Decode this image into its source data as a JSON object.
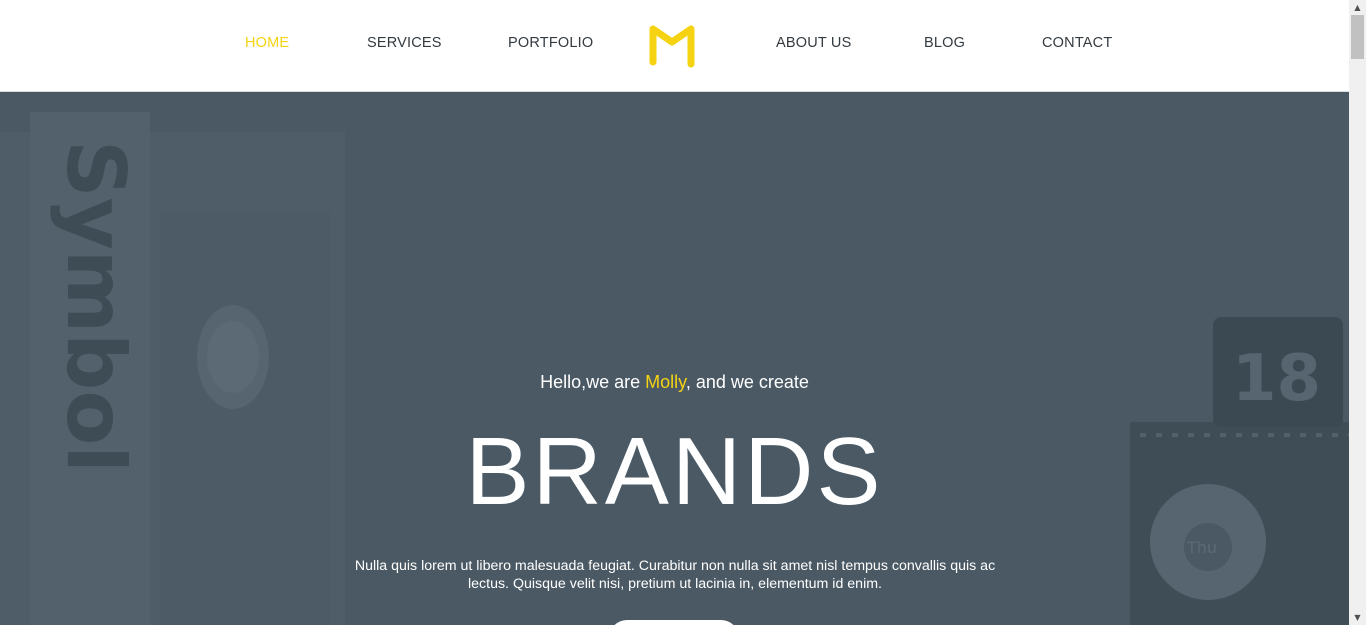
{
  "nav": {
    "items": [
      {
        "label": "HOME",
        "active": true
      },
      {
        "label": "SERVICES"
      },
      {
        "label": "PORTFOLIO"
      },
      {
        "label": "ABOUT US"
      },
      {
        "label": "BLOG"
      },
      {
        "label": "CONTACT"
      }
    ],
    "logo_icon": "m-logo-icon"
  },
  "hero": {
    "intro_before": "Hello,we are ",
    "intro_name": "Molly",
    "intro_after": ", and we create",
    "title": "BRANDS",
    "text": "Nulla quis lorem ut libero malesuada feugiat. Curabitur non nulla sit amet nisl tempus convallis quis ac lectus. Quisque velit nisi, pretium ut lacinia in, elementum id enim.",
    "bg_texts": {
      "word": "Symbol",
      "number": "18",
      "calendar": "Thu"
    }
  },
  "colors": {
    "accent": "#f5d312",
    "overlay": "#4a5964",
    "nav_text": "#333a40"
  },
  "scrollbar": {
    "up_icon": "arrow-up-icon",
    "down_icon": "arrow-down-icon"
  }
}
